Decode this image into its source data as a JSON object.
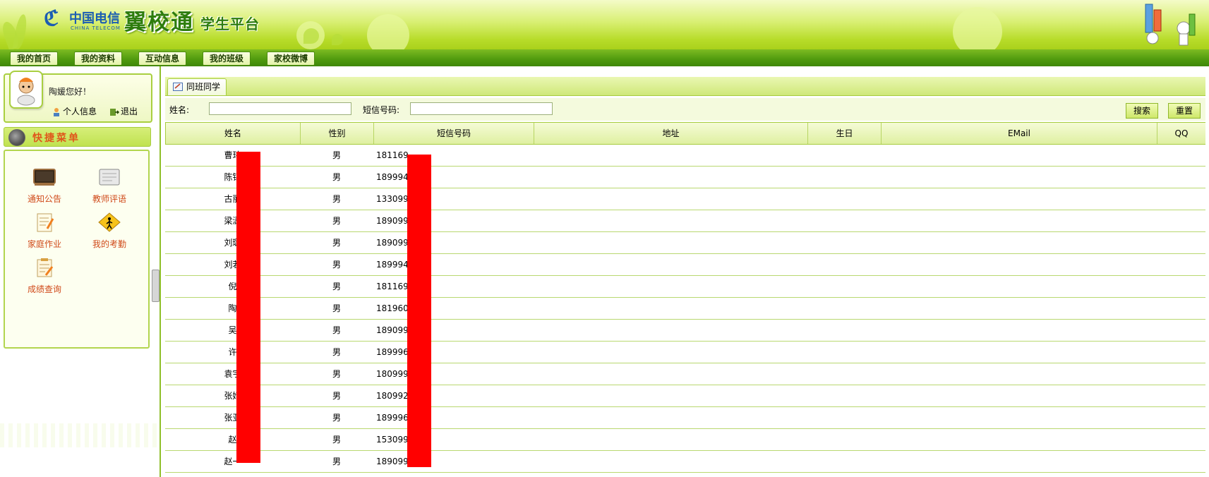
{
  "header": {
    "brand_cn": "中国电信",
    "brand_en": "CHINA TELECOM",
    "product_name": "翼校通",
    "platform_name": "学生平台"
  },
  "nav": {
    "items": [
      "我的首页",
      "我的资料",
      "互动信息",
      "我的班级",
      "家校微博"
    ]
  },
  "sidebar": {
    "greeting": "陶媛您好！",
    "profile_link": "个人信息",
    "logout_link": "退出",
    "quick_menu_title": "快捷菜单",
    "quick_items": [
      {
        "label": "通知公告",
        "icon": "board-icon"
      },
      {
        "label": "教师评语",
        "icon": "comment-icon"
      },
      {
        "label": "家庭作业",
        "icon": "homework-icon"
      },
      {
        "label": "我的考勤",
        "icon": "attendance-icon"
      },
      {
        "label": "成绩查询",
        "icon": "grades-icon"
      }
    ]
  },
  "main": {
    "tab_label": "同班同学",
    "search": {
      "name_label": "姓名:",
      "name_value": "",
      "phone_label": "短信号码:",
      "phone_value": "",
      "search_button": "搜索",
      "reset_button": "重置"
    },
    "table": {
      "columns": [
        "姓名",
        "性别",
        "短信号码",
        "地址",
        "生日",
        "EMail",
        "QQ"
      ],
      "rows": [
        {
          "name": "曹玮",
          "gender": "男",
          "phone": "181169",
          "address": "",
          "birthday": "",
          "email": "",
          "qq": ""
        },
        {
          "name": "陈锦",
          "gender": "男",
          "phone": "189994",
          "address": "",
          "birthday": "",
          "email": "",
          "qq": ""
        },
        {
          "name": "古丽",
          "gender": "男",
          "phone": "133099",
          "address": "",
          "birthday": "",
          "email": "",
          "qq": ""
        },
        {
          "name": "梁潇",
          "gender": "男",
          "phone": "189099",
          "address": "",
          "birthday": "",
          "email": "",
          "qq": ""
        },
        {
          "name": "刘璐",
          "gender": "男",
          "phone": "189099",
          "address": "",
          "birthday": "",
          "email": "",
          "qq": ""
        },
        {
          "name": "刘若",
          "gender": "男",
          "phone": "189994",
          "address": "",
          "birthday": "",
          "email": "",
          "qq": ""
        },
        {
          "name": "倪",
          "gender": "男",
          "phone": "181169",
          "address": "",
          "birthday": "",
          "email": "",
          "qq": ""
        },
        {
          "name": "陶",
          "gender": "男",
          "phone": "181960",
          "address": "",
          "birthday": "",
          "email": "",
          "qq": ""
        },
        {
          "name": "吴",
          "gender": "男",
          "phone": "189099",
          "address": "",
          "birthday": "",
          "email": "",
          "qq": ""
        },
        {
          "name": "许",
          "gender": "男",
          "phone": "189996",
          "address": "",
          "birthday": "",
          "email": "",
          "qq": ""
        },
        {
          "name": "袁宇",
          "gender": "男",
          "phone": "180999",
          "address": "",
          "birthday": "",
          "email": "",
          "qq": ""
        },
        {
          "name": "张婧",
          "gender": "男",
          "phone": "180992",
          "address": "",
          "birthday": "",
          "email": "",
          "qq": ""
        },
        {
          "name": "张亚",
          "gender": "男",
          "phone": "189996",
          "address": "",
          "birthday": "",
          "email": "",
          "qq": ""
        },
        {
          "name": "赵",
          "gender": "男",
          "phone": "153099",
          "address": "",
          "birthday": "",
          "email": "",
          "qq": ""
        },
        {
          "name": "赵一",
          "gender": "男",
          "phone": "189099",
          "address": "",
          "birthday": "",
          "email": "",
          "qq": ""
        }
      ]
    }
  },
  "colors": {
    "theme_green": "#a9d11b",
    "nav_green": "#4f9a0e",
    "quick_label": "#d04a1a",
    "redaction": "#ff0000"
  }
}
